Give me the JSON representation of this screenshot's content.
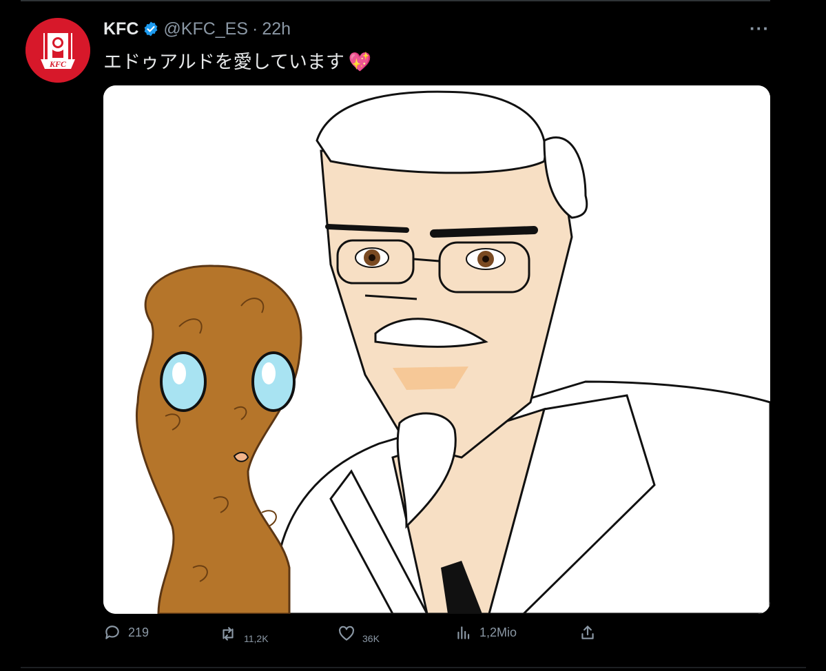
{
  "tweet": {
    "author_name": "KFC",
    "handle": "@KFC_ES",
    "separator": "·",
    "time": "22h",
    "text": "エドゥアルドを愛しています",
    "emoji": "💖",
    "more_label": "···"
  },
  "avatar": {
    "logo_text": "KFC",
    "brand_color": "#d7182a"
  },
  "media": {
    "alt": ""
  },
  "actions": {
    "replies": "219",
    "retweets": "11,2K",
    "likes": "36K",
    "views": "1,2Mio"
  },
  "colors": {
    "background": "#000000",
    "text_primary": "#e7e9ea",
    "text_secondary": "#8b98a5",
    "verified": "#1d9bf0"
  },
  "icons": [
    "kfc-logo",
    "verified-icon",
    "more-icon",
    "reply-icon",
    "retweet-icon",
    "like-icon",
    "views-icon",
    "share-icon"
  ]
}
